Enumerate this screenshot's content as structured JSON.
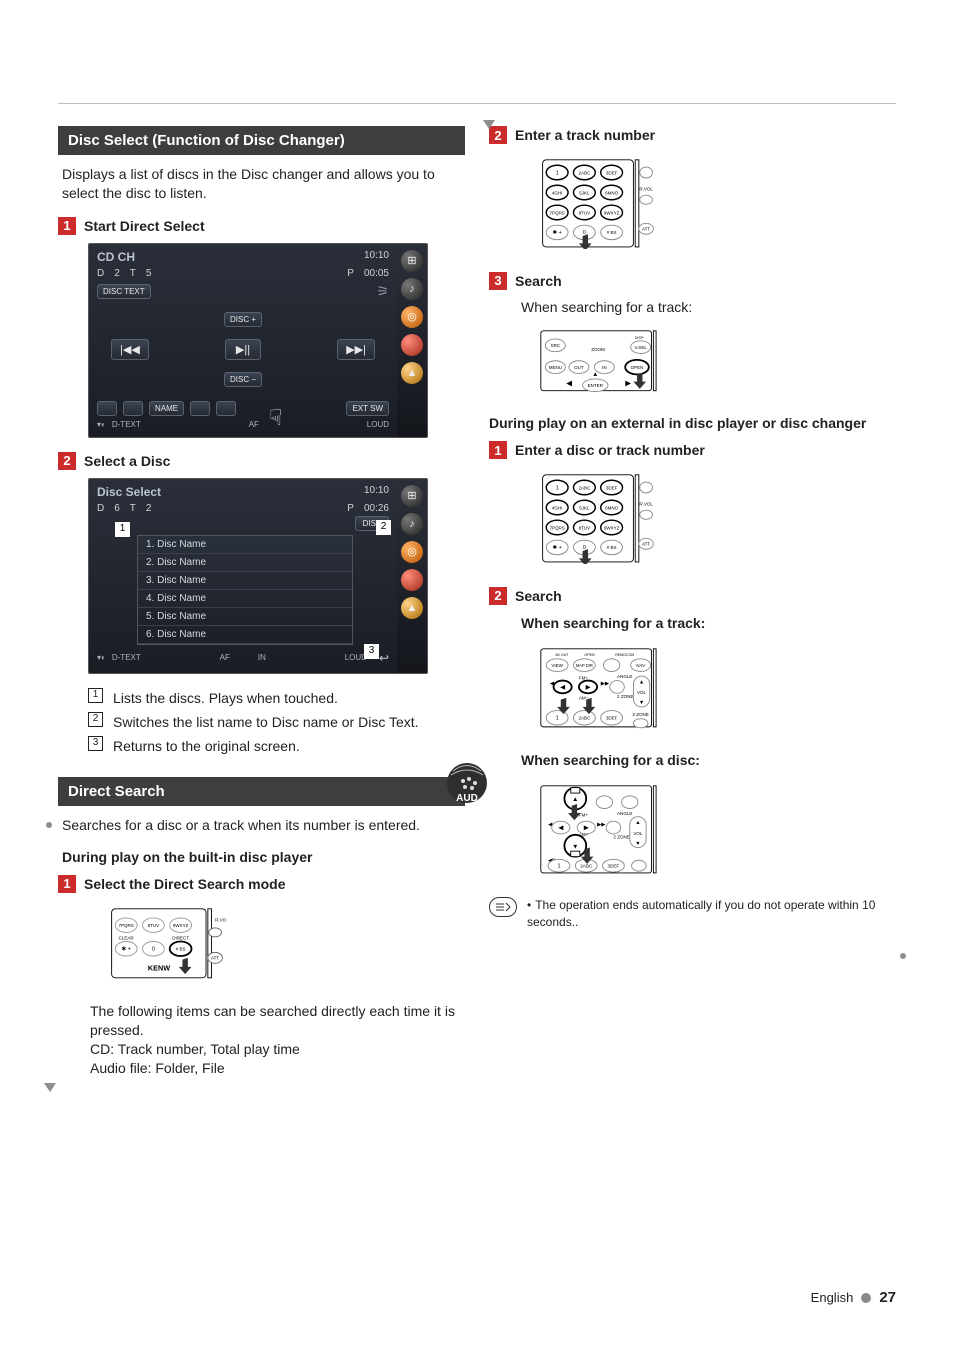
{
  "left": {
    "section1": {
      "heading": "Disc Select (Function of Disc Changer)",
      "intro": "Displays a list of discs in the Disc changer and allows you to select the disc to listen.",
      "step1": {
        "num": "1",
        "title": "Start Direct Select"
      },
      "screen1": {
        "title": "CD CH",
        "clock": "10:10",
        "d": "D",
        "dval": "2",
        "t": "T",
        "tval": "5",
        "p": "P",
        "time": "00:05",
        "disctext": "DISC TEXT",
        "discplus": "DISC +",
        "prev": "|◀◀",
        "play": "▶||",
        "next": "▶▶|",
        "discminus": "DISC −",
        "name": "NAME",
        "extsw": "EXT SW",
        "dtext": "D-TEXT",
        "af": "AF",
        "loud": "LOUD"
      },
      "step2": {
        "num": "2",
        "title": "Select a Disc"
      },
      "screen2": {
        "title": "Disc Select",
        "clock": "10:10",
        "d": "D",
        "dval": "6",
        "t": "T",
        "tval": "2",
        "p": "P",
        "time": "00:26",
        "disp": "DISP",
        "listitems": [
          "1. Disc Name",
          "2. Disc Name",
          "3. Disc Name",
          "4. Disc Name",
          "5. Disc Name",
          "6. Disc Name"
        ],
        "dtext": "D-TEXT",
        "af": "AF",
        "in": "IN",
        "loud": "LOUD"
      },
      "callouts": {
        "c1": "Lists the discs. Plays when touched.",
        "c2": "Switches the list name to Disc name or Disc Text.",
        "c3": "Returns to the original screen."
      }
    },
    "section2": {
      "heading": "Direct Search",
      "intro": "Searches for a disc or a track when its number is entered.",
      "sub1": "During play on the built-in disc player",
      "step1": {
        "num": "1",
        "title": "Select the Direct Search mode"
      },
      "note": "The following items can be searched directly each time it is pressed.\nCD: Track number, Total play time\nAudio file: Folder, File"
    }
  },
  "right": {
    "stepA": {
      "num": "2",
      "title": "Enter a track number"
    },
    "stepB": {
      "num": "3",
      "title": "Search"
    },
    "stepB_note": "When searching for a track:",
    "sub2": "During play on an external in disc player or disc changer",
    "stepC": {
      "num": "1",
      "title": "Enter a disc or track number"
    },
    "stepD": {
      "num": "2",
      "title": "Search"
    },
    "stepD_note1": "When searching for a track:",
    "stepD_note2": "When searching for a disc:",
    "info": "The operation ends automatically if you do not operate within 10 seconds.."
  },
  "remote": {
    "keys": [
      "1",
      "2ABC",
      "3DEF",
      "4GHI",
      "5JKL",
      "6MNO",
      "7PQRS",
      "8TUV",
      "9WXYZ",
      "*  +",
      "0",
      "#  BS"
    ],
    "att": "ATT",
    "rvol": "R.VOL",
    "clear": "CLEAR",
    "direct": "DIRECT",
    "kenwood": "KENW",
    "src": "SRC",
    "vsel": "V.SEL",
    "menu": "MENU",
    "out": "OUT",
    "in_": "IN",
    "open": "OPEN",
    "zoom": "ZOOM",
    "enter": "ENTER",
    "disp": "DISP",
    "view": "VIEW",
    "mapdir": "MAP DIR",
    "nav": "NAV",
    "fm": "FM+",
    "am": "AM−",
    "angle": "ANGLE",
    "vol": "VOL",
    "twozone": "2 ZONE",
    "avout": "AV OUT",
    "remocon": "REMOCON"
  },
  "footer": {
    "lang": "English",
    "page": "27"
  },
  "aud_label": "AUD",
  "chart_data": null
}
